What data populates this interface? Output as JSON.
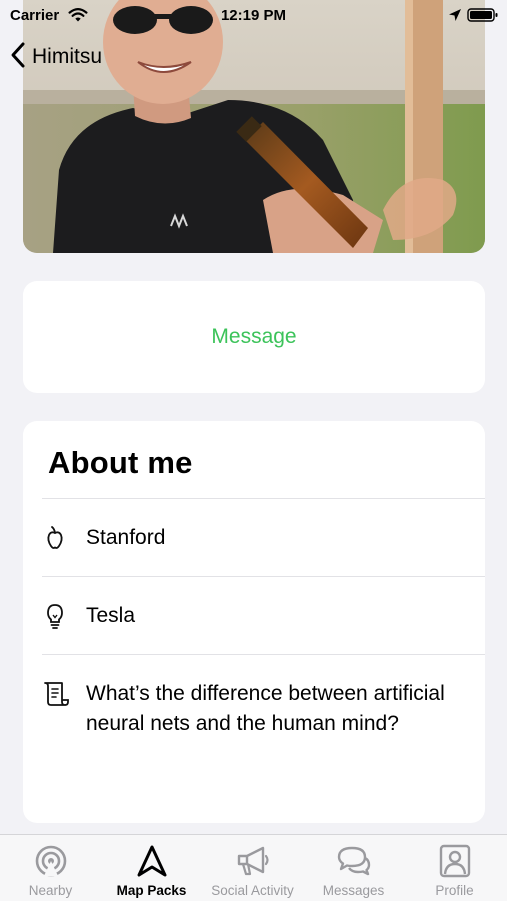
{
  "status_bar": {
    "carrier": "Carrier",
    "time": "12:19 PM"
  },
  "nav": {
    "back_label": "Himitsu"
  },
  "actions": {
    "message_label": "Message"
  },
  "about": {
    "title": "About me",
    "items": [
      {
        "icon": "apple-icon",
        "text": "Stanford"
      },
      {
        "icon": "lightbulb-icon",
        "text": "Tesla"
      },
      {
        "icon": "scroll-icon",
        "text": "What’s the difference between artificial neural nets and the human mind?"
      }
    ]
  },
  "tab_bar": {
    "tabs": [
      {
        "label": "Nearby",
        "icon": "nearby-icon",
        "active": false
      },
      {
        "label": "Map Packs",
        "icon": "navigation-arrow-icon",
        "active": true
      },
      {
        "label": "Social Activity",
        "icon": "megaphone-icon",
        "active": false
      },
      {
        "label": "Messages",
        "icon": "chat-bubbles-icon",
        "active": false
      },
      {
        "label": "Profile",
        "icon": "profile-icon",
        "active": false
      }
    ]
  },
  "colors": {
    "accent_green": "#3cc35a",
    "background": "#f2f2f6",
    "tab_inactive": "#9a9a9e",
    "tab_active": "#000000"
  }
}
